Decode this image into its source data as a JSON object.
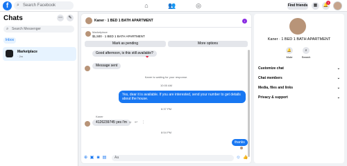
{
  "topbar": {
    "logo": "f",
    "search_placeholder": "Search Facebook",
    "nav_icons": [
      "home-icon",
      "friends-icon",
      "groups-icon"
    ],
    "find_friends": "Find friends",
    "notif_count": "1"
  },
  "sidebar": {
    "title": "Chats",
    "search_placeholder": "Search Messenger",
    "inbox_tab": "Inbox",
    "conversations": [
      {
        "name": "Marketplace",
        "time": "· 2m"
      }
    ]
  },
  "chat": {
    "name": "Kaner · 1 BED 1 BATH APARTMENT",
    "mp_label": "Marketplace",
    "mp_title": "$1,500 · 1 BED 1 BATH APARTMENT",
    "btn_pending": "Mark as pending",
    "btn_more": "More options",
    "messages": {
      "m1": "Good afternoon, is this still available?",
      "m2": "Message sent",
      "note_waiting": "Kaner is waiting for your response.",
      "time1": "10:00 AM",
      "m3": "Yes, dear it is available. If you are interested, send your number to get details about the house.",
      "time2": "6:37 PM",
      "sender": "Kaner",
      "m4": "4126239745 yes I'm",
      "time3": "8:54 PM",
      "m5": "thanks"
    },
    "composer_placeholder": "Aa"
  },
  "right_panel": {
    "name": "Kaner · 1 BED 1 BATH APARTMENT",
    "mute": "Mute",
    "search": "Search",
    "rows": [
      "Customize chat",
      "Chat members",
      "Media, files and links",
      "Privacy & support"
    ]
  },
  "colors": {
    "accent": "#1877f2",
    "info": "#8a2be2"
  }
}
